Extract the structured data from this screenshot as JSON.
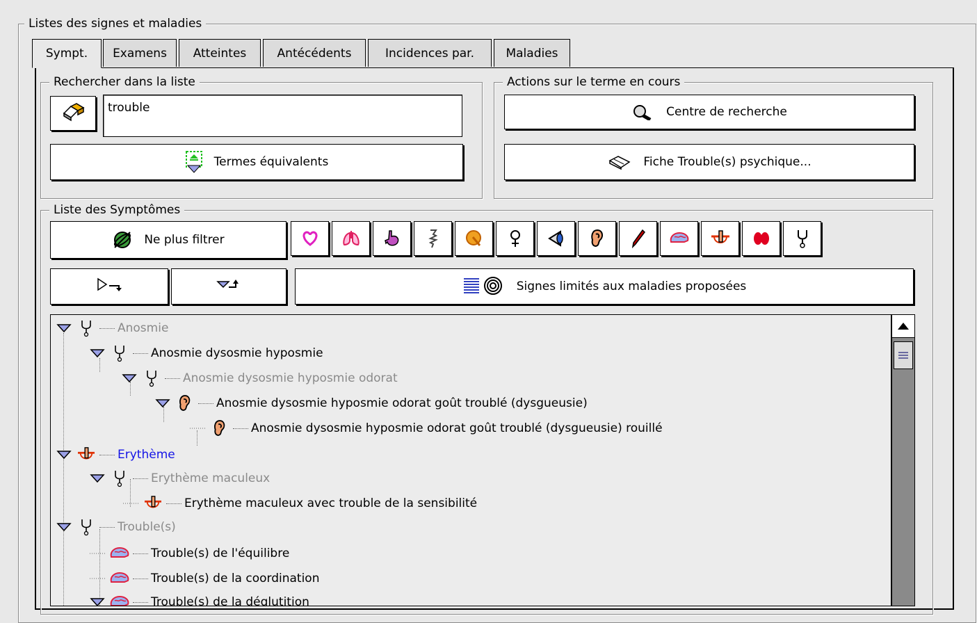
{
  "window": {
    "group_title": "Listes des signes et maladies"
  },
  "tabs": [
    {
      "label": "Sympt.",
      "active": true
    },
    {
      "label": "Examens",
      "active": false
    },
    {
      "label": "Atteintes",
      "active": false
    },
    {
      "label": "Antécédents",
      "active": false
    },
    {
      "label": "Incidences par.",
      "active": false
    },
    {
      "label": "Maladies",
      "active": false
    }
  ],
  "search": {
    "group_title": "Rechercher dans la liste",
    "value": "trouble",
    "clear_icon": "eraser-icon",
    "equiv_label": "Termes équivalents",
    "equiv_icon": "equivalence-icon"
  },
  "actions": {
    "group_title": "Actions sur le terme en cours",
    "research_label": "Centre de recherche",
    "research_icon": "magnifier-icon",
    "sheet_label": "Fiche Trouble(s) psychique...",
    "sheet_icon": "open-book-icon"
  },
  "symptoms": {
    "group_title": "Liste des Symptômes",
    "unfilter_label": "Ne plus filtrer",
    "unfilter_icon": "globe-icon",
    "filter_icons": [
      "heart-icon",
      "lungs-icon",
      "stomach-icon",
      "bone-icon",
      "brain-yellow-icon",
      "female-icon",
      "eye-icon",
      "ear-icon",
      "scalpel-icon",
      "brain-icon",
      "skin-icon",
      "kidneys-icon",
      "stethoscope-icon"
    ],
    "expand_icon": "expand-arrow-icon",
    "collapse_icon": "collapse-arrow-icon",
    "limit_label": "Signes limités aux maladies proposées",
    "limit_icon": "target-list-icon"
  },
  "tree": [
    {
      "label": "Anosmie",
      "style": "gray",
      "icon": "stethoscope-icon",
      "expanded": true
    },
    {
      "label": "Anosmie dysosmie hyposmie",
      "style": "black",
      "icon": "stethoscope-icon",
      "expanded": true
    },
    {
      "label": "Anosmie dysosmie hyposmie odorat",
      "style": "gray",
      "icon": "stethoscope-icon",
      "expanded": true
    },
    {
      "label": "Anosmie dysosmie hyposmie odorat goût troublé (dysgueusie)",
      "style": "black",
      "icon": "ear-icon",
      "expanded": true
    },
    {
      "label": "Anosmie dysosmie hyposmie odorat goût troublé (dysgueusie) rouillé",
      "style": "black",
      "icon": "ear-icon",
      "expanded": false
    },
    {
      "label": "Erythème",
      "style": "blue",
      "icon": "skin-icon",
      "expanded": true
    },
    {
      "label": "Erythème maculeux",
      "style": "gray",
      "icon": "stethoscope-icon",
      "expanded": true
    },
    {
      "label": "Erythème maculeux avec trouble de la sensibilité",
      "style": "black",
      "icon": "skin-icon",
      "expanded": false
    },
    {
      "label": "Trouble(s)",
      "style": "gray",
      "icon": "stethoscope-icon",
      "expanded": true
    },
    {
      "label": "Trouble(s) de l'équilibre",
      "style": "black",
      "icon": "brain-icon",
      "expanded": false
    },
    {
      "label": "Trouble(s) de la coordination",
      "style": "black",
      "icon": "brain-icon",
      "expanded": false
    },
    {
      "label": "Trouble(s) de la déglutition",
      "style": "black",
      "icon": "brain-icon",
      "expanded": true
    }
  ]
}
